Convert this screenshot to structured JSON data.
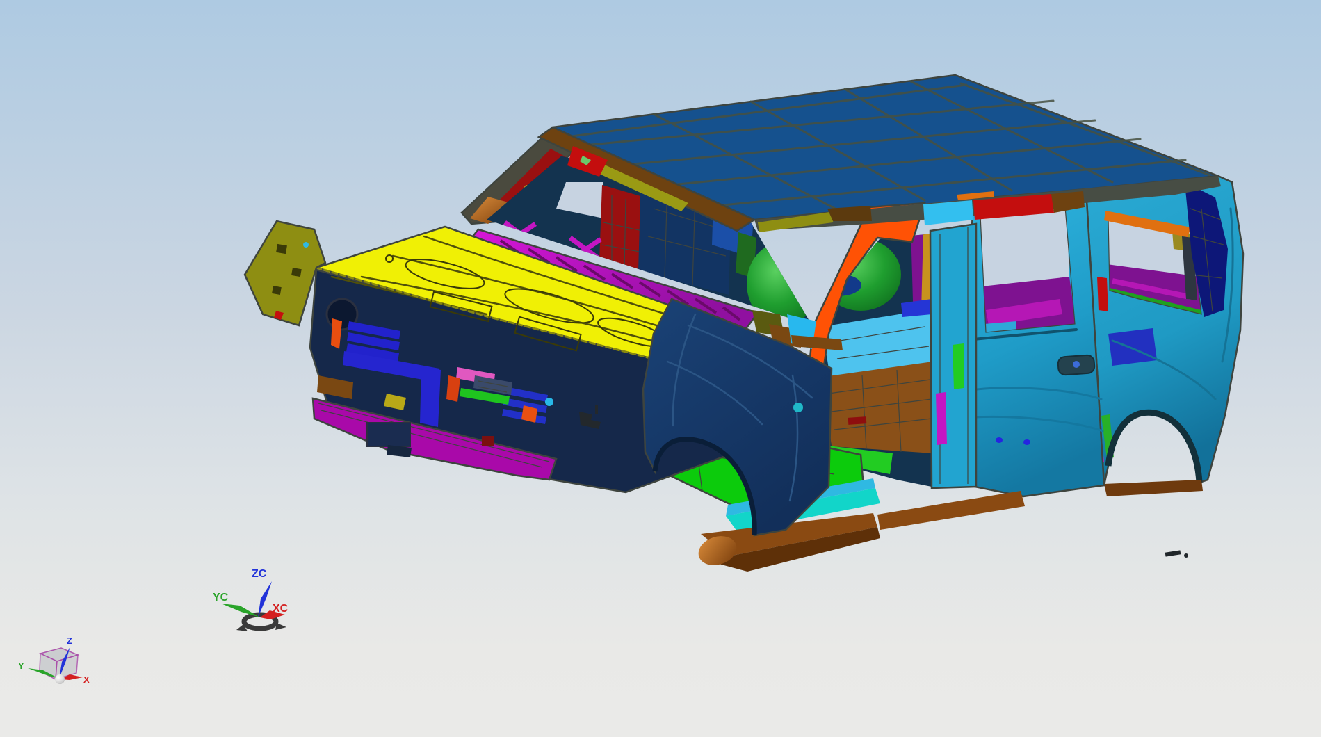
{
  "viewport": {
    "type": "3d-cad-viewport",
    "background": {
      "sky_top": "#AECAE2",
      "sky_mid": "#CBD6E2",
      "horizon": "#DEE3E6",
      "ground": "#E9E9E7"
    }
  },
  "model": {
    "name": "suv-body-in-white",
    "parts": [
      {
        "name": "roof-panel",
        "color": "#15518E"
      },
      {
        "name": "hood-panel",
        "color": "#F0F005"
      },
      {
        "name": "front-fender",
        "color": "#16396B"
      },
      {
        "name": "body-side-outer",
        "color": "#22A4D0"
      },
      {
        "name": "rear-door",
        "color": "#25ABD6"
      },
      {
        "name": "quarter-panel",
        "color": "#219FC9"
      },
      {
        "name": "windshield-header-rail",
        "color": "#6E4210"
      },
      {
        "name": "a-pillar-hinge-pillar",
        "color": "#FF5205"
      },
      {
        "name": "cowl-brace",
        "color": "#C013C0"
      },
      {
        "name": "bumper-beam",
        "color": "#A909A9"
      },
      {
        "name": "grille-slats",
        "color": "#2222CC"
      },
      {
        "name": "floor-pan-front",
        "color": "#0CCB0C"
      },
      {
        "name": "floor-pan-mid",
        "color": "#4EC3EE"
      },
      {
        "name": "floor-pan-rear",
        "color": "#8A5018"
      },
      {
        "name": "rocker-sill",
        "color": "#12D5C9"
      },
      {
        "name": "sill-outer",
        "color": "#8A4A12"
      },
      {
        "name": "seat-frame",
        "color": "#1F9E2F"
      },
      {
        "name": "interior-quarter-trim",
        "color": "#7E1290"
      },
      {
        "name": "roof-rail-parts",
        "color": "#C40E0E"
      },
      {
        "name": "b-pillar-reinforcement",
        "color": "#22CC22"
      },
      {
        "name": "d-pillar-glass-panel",
        "color": "#0D1778"
      },
      {
        "name": "fender-cap",
        "color": "#74740E"
      }
    ]
  },
  "colors": {
    "roof": "#15518E",
    "roof_line": "#46503F",
    "edge": "#3E443E",
    "hood": "#F0F005",
    "hood_line": "#50500A",
    "fender": "#16396B",
    "fender_line": "#2B5585",
    "side": "#22A4D0",
    "side_dark": "#10607F",
    "door": "#25ABD6",
    "quarter": "#219FC9",
    "rocker": "#12D5C9",
    "rocker_cyan": "#2FB9E2",
    "sill": "#8A4A12",
    "sill_dark": "#5E3008",
    "copper": "#B4651E",
    "floor_green": "#0CCB0C",
    "green_line": "#077A07",
    "floor_cyan": "#4EC3EE",
    "floor_brown": "#8A5018",
    "brown_line": "#5E3408",
    "cowl": "#C013C0",
    "cowl_dark": "#6A0A6A",
    "purple_dk": "#5A0A64",
    "bumper": "#A909A9",
    "grille": "#2222CC",
    "royal": "#2525CF",
    "orange": "#FF5205",
    "orange2": "#E07010",
    "header": "#6E4210",
    "brown_dk": "#5C3A0E",
    "olive": "#8E8E12",
    "olive2": "#9A9A14",
    "olive_dk": "#5A5A10",
    "red": "#C40E0E",
    "red_dk": "#9A1010",
    "red_brick": "#8E0E0E",
    "seat": "#1F9E2F",
    "seat_hi": "#5AD060",
    "green_br": "#22CC22",
    "green_mid": "#1FA01F",
    "green_dk": "#1F6A1F",
    "purple": "#7E1290",
    "mag_tube": "#B517B5",
    "mag": "#C316C3",
    "gold": "#C8921E",
    "navy": "#123463",
    "ip": "#13334F",
    "deep": "#2230C0",
    "dblue_bar": "#2535D5",
    "dpillar": "#0D1778",
    "steel": "#1B4FA8",
    "pink": "#E058C0",
    "cyan_piece": "#33BFEF",
    "cyan_wedge": "#28B8EE",
    "bg_glass": "#C7D3E1",
    "dark_part": "#23282C",
    "frame": "#474D44",
    "handle": "#24424E"
  },
  "wcs_triad": {
    "x": {
      "label": "XC",
      "color": "#D42020"
    },
    "y": {
      "label": "YC",
      "color": "#2AA42A"
    },
    "z": {
      "label": "ZC",
      "color": "#2233D9"
    }
  },
  "view_triad": {
    "x": {
      "label": "X",
      "color": "#D42020"
    },
    "y": {
      "label": "Y",
      "color": "#2AA42A"
    },
    "z": {
      "label": "Z",
      "color": "#2233D9"
    },
    "cube_edge": "#A84AA8",
    "cube_face": "#C9CBCE"
  }
}
